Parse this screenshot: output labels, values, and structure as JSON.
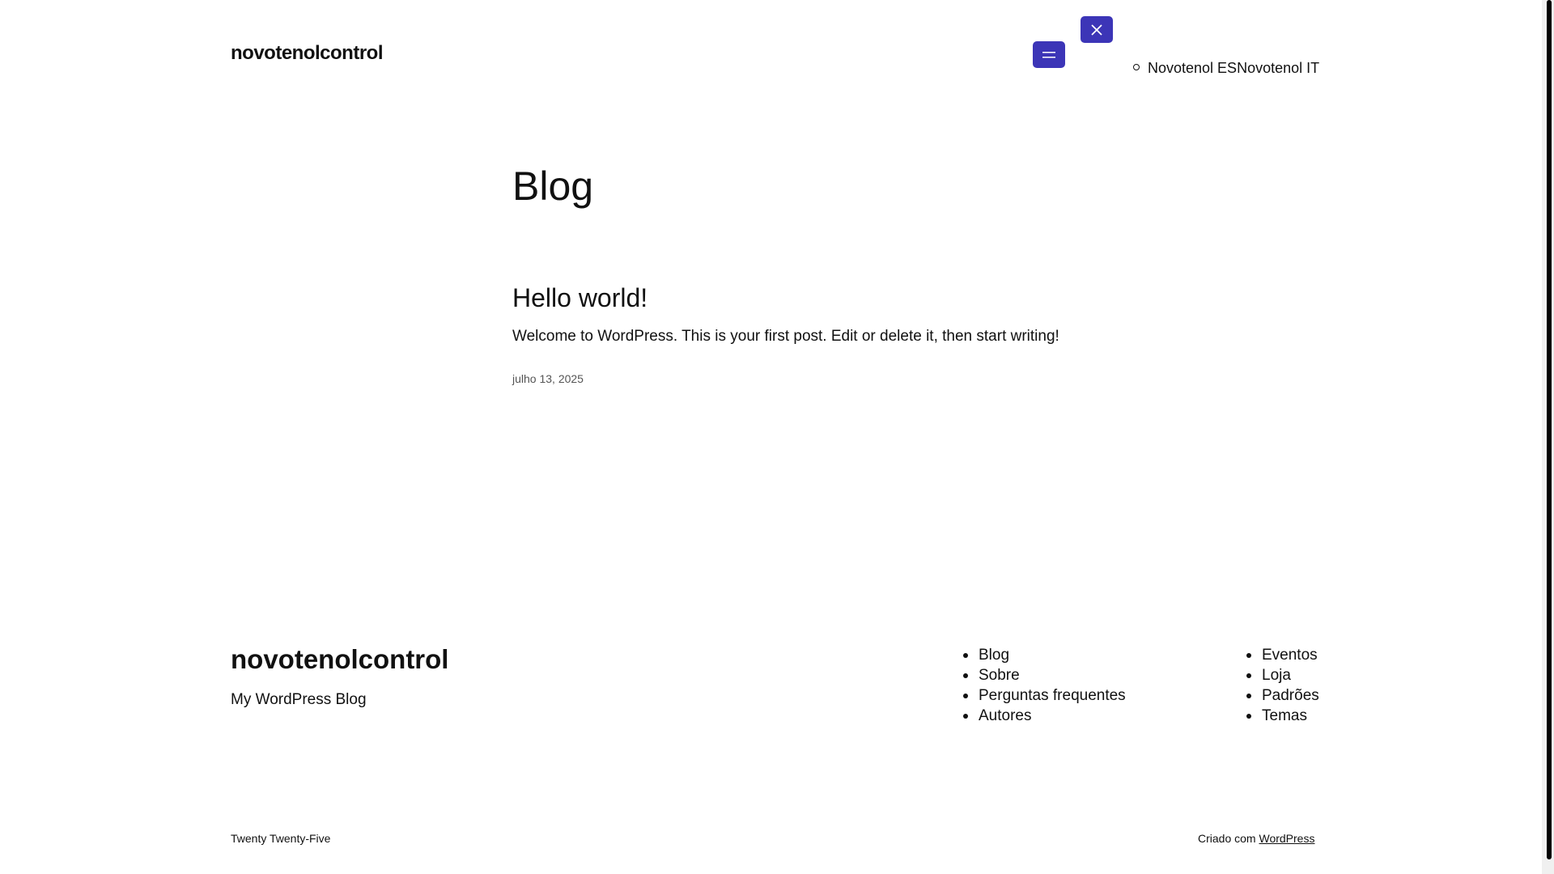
{
  "header": {
    "site_title": "novotenolcontrol",
    "language_links": [
      "Novotenol ES",
      "Novotenol IT"
    ]
  },
  "main": {
    "page_title": "Blog",
    "post": {
      "title": "Hello world!",
      "excerpt": "Welcome to WordPress. This is your first post. Edit or delete it, then start writing!",
      "date": "julho 13, 2025"
    }
  },
  "footer": {
    "site_title": "novotenolcontrol",
    "tagline": "My WordPress Blog",
    "nav_col_1": [
      "Blog",
      "Sobre",
      "Perguntas frequentes",
      "Autores"
    ],
    "nav_col_2": [
      "Eventos",
      "Loja",
      "Padrões",
      "Temas"
    ],
    "theme_credit": "Twenty Twenty-Five",
    "built_with_prefix": "Criado com",
    "built_with_link": "WordPress"
  },
  "colors": {
    "accent": "#3c35b7",
    "text": "#111111",
    "muted": "#555555",
    "background": "#ffffff"
  },
  "icons": {
    "menu_open": "hamburger-icon",
    "menu_close": "close-icon"
  }
}
